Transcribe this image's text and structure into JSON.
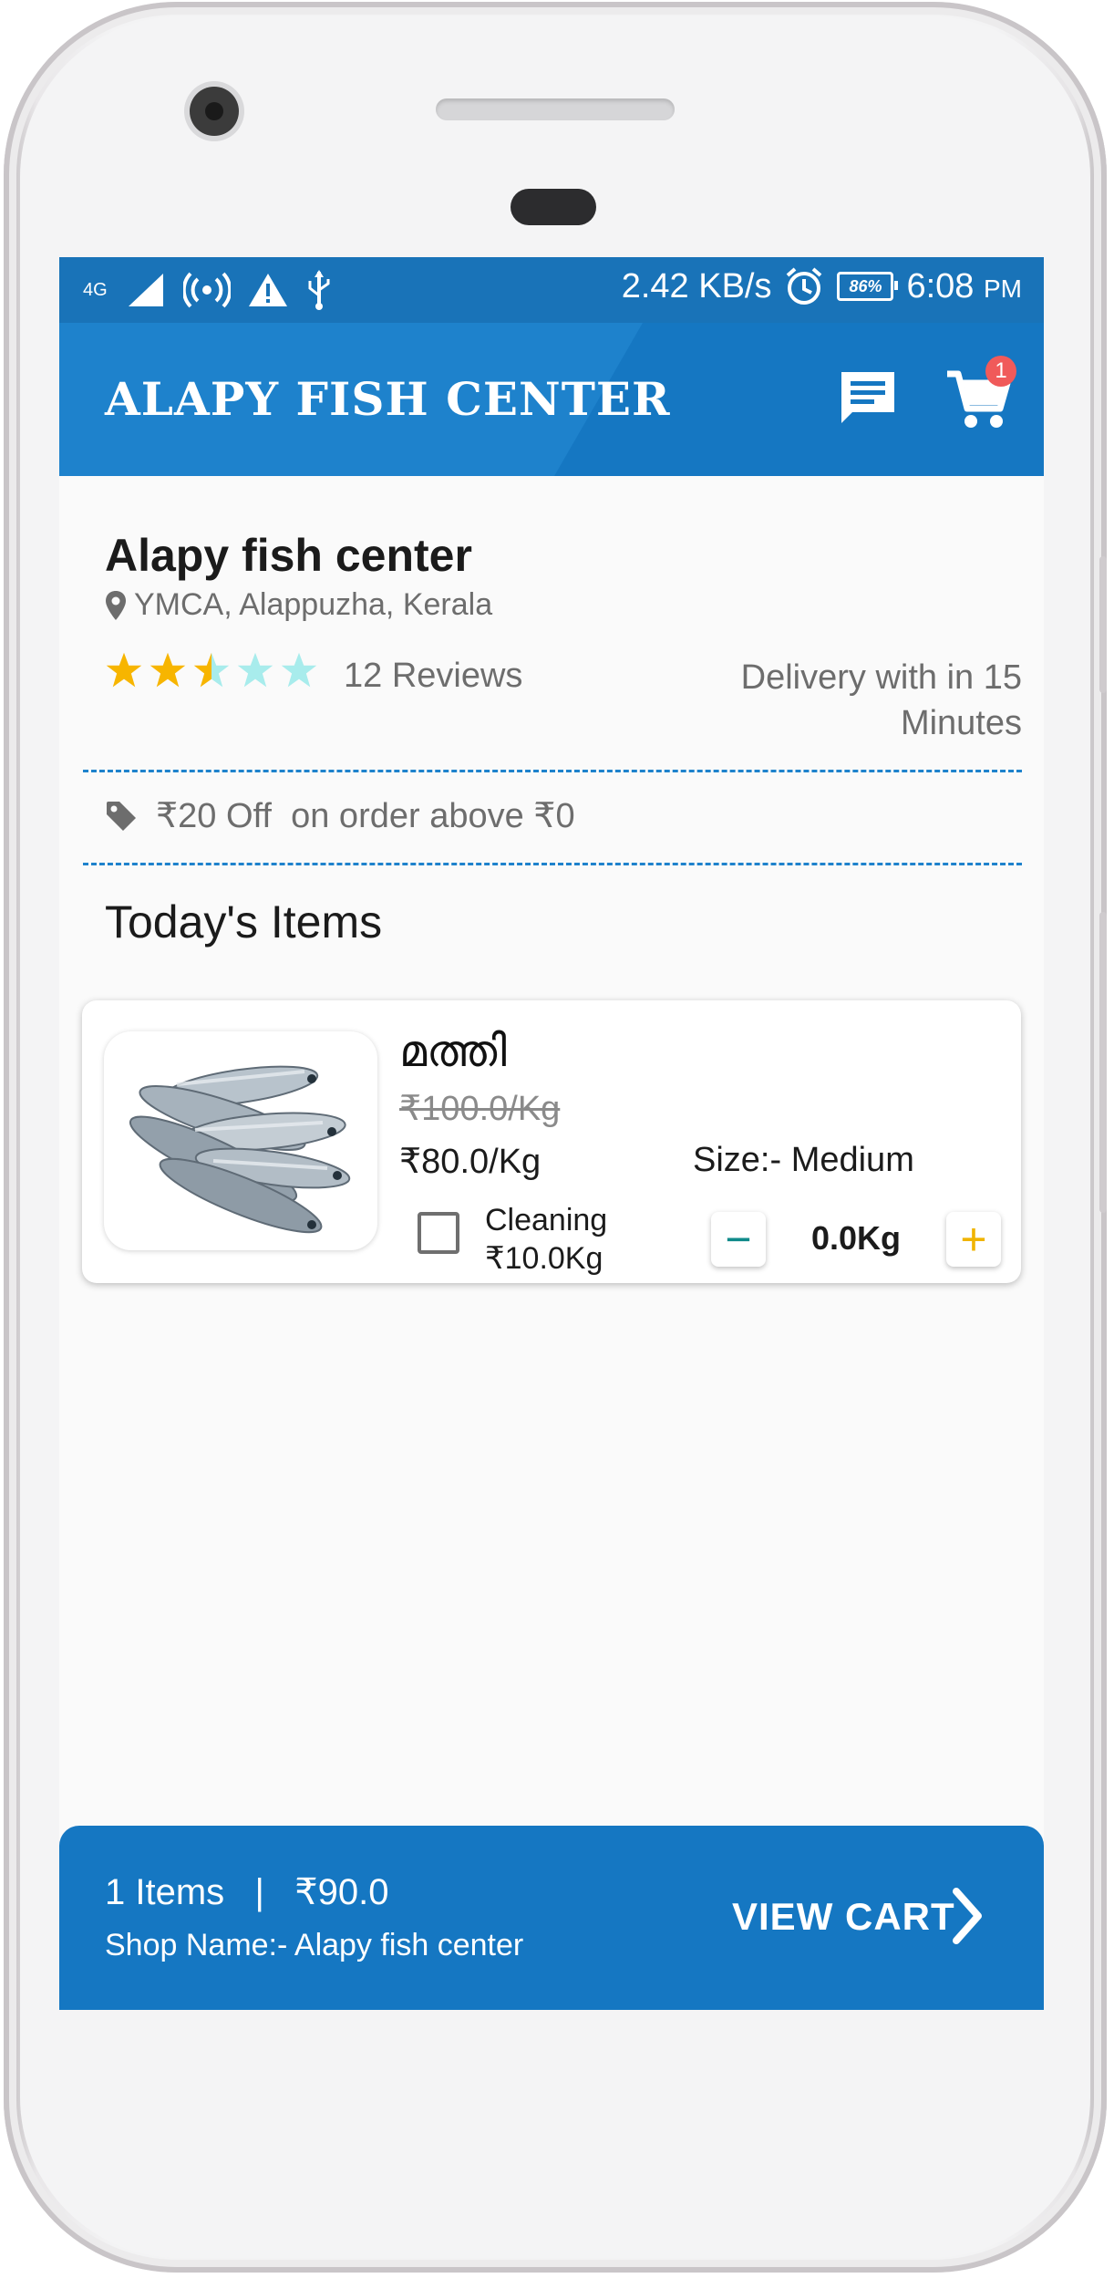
{
  "status_bar": {
    "network_label": "4G",
    "speed": "2.42 KB/s",
    "battery": "86%",
    "time": "6:08",
    "ampm": "PM"
  },
  "app_bar": {
    "title": "ALAPY FISH CENTER",
    "cart_count": "1"
  },
  "shop": {
    "name": "Alapy fish center",
    "location": "YMCA, Alappuzha, Kerala",
    "rating": 2.5,
    "max_rating": 5,
    "reviews": "12 Reviews",
    "delivery": "Delivery with in 15 Minutes"
  },
  "offer": {
    "text": "₹20 Off  on order above ₹0"
  },
  "section": {
    "title": "Today's Items"
  },
  "items": [
    {
      "name": "മത്തി",
      "old_price": "₹100.0/Kg",
      "price": "₹80.0/Kg",
      "size": "Size:- Medium",
      "cleaning_label": "Cleaning",
      "cleaning_price": "₹10.0Kg",
      "cleaning_checked": false,
      "quantity": "0.0Kg",
      "minus_label": "−",
      "plus_label": "+"
    }
  ],
  "bottom_bar": {
    "summary": "1 Items   |   ₹90.0",
    "shop": "Shop Name:- Alapy fish center",
    "action": "VIEW CART"
  },
  "colors": {
    "primary": "#1577c2",
    "star_filled": "#f7b500",
    "star_empty": "#a8ecec",
    "minus": "#0f8a8a",
    "plus": "#f0b400",
    "badge": "#f05a5a"
  }
}
